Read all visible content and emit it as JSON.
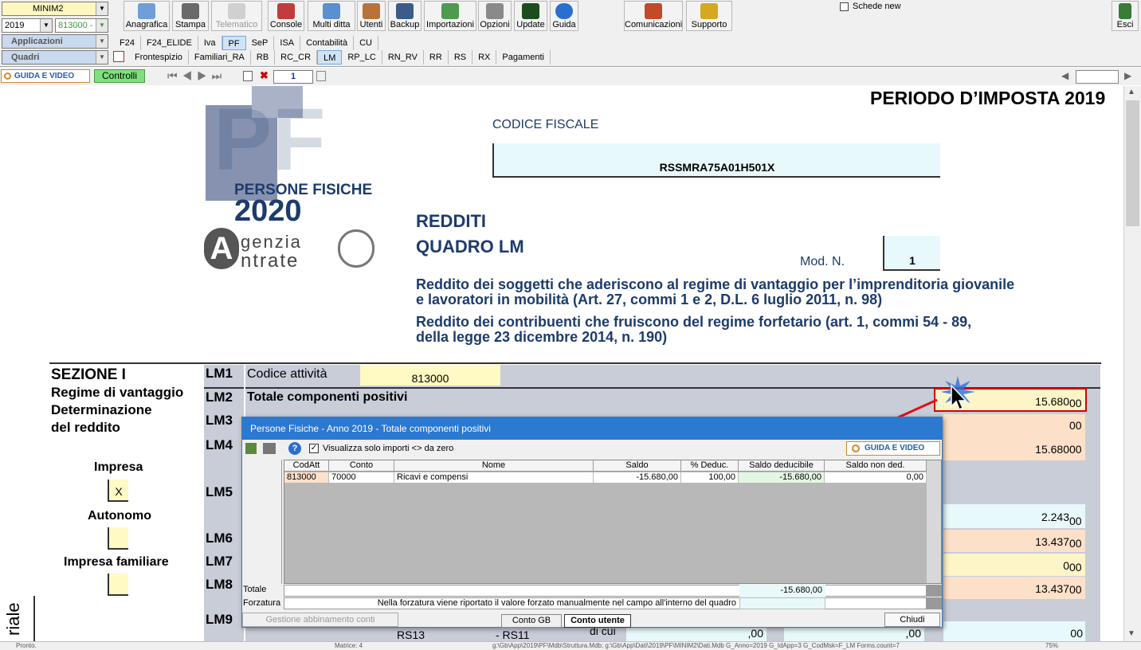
{
  "toolbar": {
    "company": "MINIM2",
    "year": "2019",
    "code": "813000 -",
    "applicazioni": "Applicazioni",
    "quadri": "Quadri",
    "buttons": [
      "Anagrafica",
      "Stampa",
      "Telematico",
      "Console",
      "Multi ditta",
      "Utenti",
      "Backup",
      "Importazioni",
      "Opzioni",
      "Update",
      "Guida"
    ],
    "comunicazioni": "Comunicazioni",
    "supporto": "Supporto",
    "schede": "Schede new",
    "esci": "Esci"
  },
  "apptabs": [
    "F24",
    "F24_ELIDE",
    "Iva",
    "PF",
    "SeP",
    "ISA",
    "Contabilità",
    "CU"
  ],
  "quadritabs": [
    "Frontespizio",
    "Familiari_RA",
    "RB",
    "RC_CR",
    "LM",
    "RP_LC",
    "RN_RV",
    "RR",
    "RS",
    "RX",
    "Pagamenti"
  ],
  "nav": {
    "guida": "GUIDA E VIDEO",
    "controlli": "Controlli",
    "page": "1"
  },
  "form": {
    "periodo": "PERIODO D’IMPOSTA 2019",
    "codice_fiscale_label": "CODICE FISCALE",
    "codice_fiscale": "RSSMRA75A01H501X",
    "logo_pf": "PF",
    "logo_persone": "PERSONE FISICHE",
    "logo_year": "2020",
    "agenzia": "genzia",
    "entrate": "ntrate",
    "redditi": "REDDITI",
    "quadro": "QUADRO LM",
    "mod_label": "Mod. N.",
    "mod_value": "1",
    "desc1": "Reddito dei soggetti che aderiscono al regime di vantaggio per l’imprenditoria giovanile",
    "desc2": "e lavoratori in mobilità (Art. 27, commi 1 e 2, D.L. 6 luglio 2011, n. 98)",
    "desc3": "Reddito dei contribuenti che fruiscono del regime forfetario (art. 1, commi 54 - 89,",
    "desc4": "della legge 23 dicembre 2014, n. 190)",
    "sez1": "SEZIONE I",
    "sez2": "Regime di vantaggio",
    "sez3": "Determinazione",
    "sez4": "del reddito",
    "impresa": "Impresa",
    "impresa_val": "X",
    "autonomo": "Autonomo",
    "familiare": "Impresa familiare",
    "side": "riale",
    "lm1": "LM1",
    "lm1_label": "Codice attività",
    "lm1_value": "813000",
    "lm2": "LM2",
    "lm2_label": "Totale componenti positivi",
    "lm2_value": "15.680",
    "lm3": "LM3",
    "lm4": "LM4",
    "lm4_value": "15.680",
    "lm5": "LM5",
    "lm5_value": "2.243",
    "lm6": "LM6",
    "lm6_value": "13.437",
    "lm7": "LM7",
    "lm7_value": "0",
    "lm8": "LM8",
    "lm8_value": "13.437",
    "lm9": "LM9",
    "dec": "00",
    "rs13": "RS13",
    "rs11": "- RS11",
    "dicui": "di cui",
    "zero": ",00"
  },
  "dialog": {
    "title": "Persone Fisiche - Anno 2019 - Totale componenti positivi",
    "check_label": "Visualizza solo importi <> da zero",
    "guida": "GUIDA E VIDEO",
    "headers": [
      "CodAtt",
      "Conto",
      "Nome",
      "Saldo",
      "% Deduc.",
      "Saldo deducibile",
      "Saldo non ded."
    ],
    "row": [
      "813000",
      "70000",
      "Ricavi e compensi",
      "-15.680,00",
      "100,00",
      "-15.680,00",
      "0,00"
    ],
    "totale_label": "Totale",
    "totale_value": "-15.680,00",
    "forzatura_label": "Forzatura",
    "forzatura_text": "Nella forzatura viene riportato il valore forzato manualmente nel campo all'interno del quadro",
    "gestione": "Gestione abbinamento conti",
    "conto_gb": "Conto GB",
    "conto_utente": "Conto utente",
    "chiudi": "Chiudi"
  },
  "status": {
    "left": "Pronto.",
    "matrice": "Matrice: 4",
    "path": "g:\\Gb\\App\\2019\\PF\\Mdb\\Struttura.Mdb; g:\\Gb\\App\\Dati\\2019\\PF\\MINIM2\\Dati.Mdb G_Anno=2019 G_IdApp=3 G_CodMsk=F_LM Forms.count=7",
    "zoom": "75%"
  }
}
